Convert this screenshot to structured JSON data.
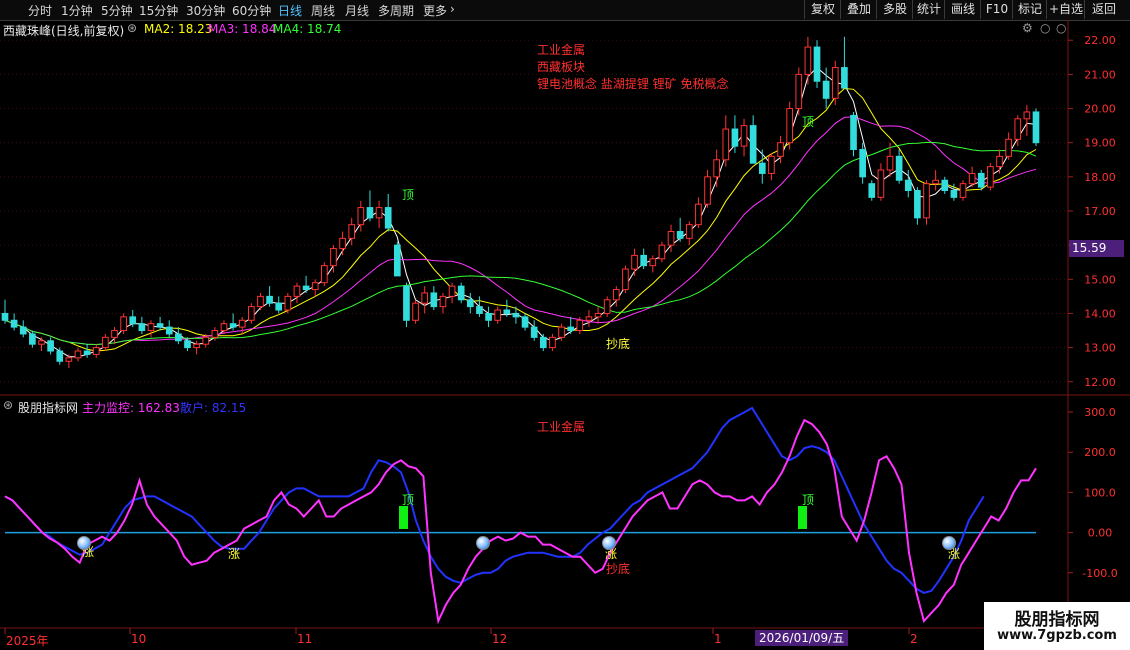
{
  "period_tabs": [
    {
      "label": "分时",
      "active": false
    },
    {
      "label": "1分钟",
      "active": false
    },
    {
      "label": "5分钟",
      "active": false
    },
    {
      "label": "15分钟",
      "active": false
    },
    {
      "label": "30分钟",
      "active": false
    },
    {
      "label": "60分钟",
      "active": false
    },
    {
      "label": "日线",
      "active": true
    },
    {
      "label": "周线",
      "active": false
    },
    {
      "label": "月线",
      "active": false
    },
    {
      "label": "多周期",
      "active": false
    },
    {
      "label": "更多",
      "active": false
    }
  ],
  "toolbar": [
    "复权",
    "叠加",
    "多股",
    "统计",
    "画线",
    "F10",
    "标记",
    "+自选",
    "返回"
  ],
  "main_chart": {
    "title": "西藏珠峰(日线,前复权)",
    "ma_legend": [
      {
        "label": "MA2: 18.23",
        "color": "#ffff00"
      },
      {
        "label": "MA3: 18.84",
        "color": "#ff33ff"
      },
      {
        "label": "MA4: 18.74",
        "color": "#33ff33"
      }
    ],
    "info_lines": [
      "工业金属",
      "西藏板块",
      "锂电池概念 盐湖提锂 锂矿 免税概念"
    ],
    "signals": {
      "top": "顶",
      "bottom": "抄底"
    },
    "price_axis": [
      "22.00",
      "21.00",
      "20.00",
      "19.00",
      "18.00",
      "17.00",
      "16.00",
      "15.00",
      "14.00",
      "13.00",
      "12.00"
    ],
    "current_price": "15.59"
  },
  "indicator": {
    "title": "股朋指标网",
    "legend": [
      {
        "label": "主力监控: 162.83",
        "color": "#ff33ff"
      },
      {
        "label": "散户: 82.15",
        "color": "#3333ff"
      }
    ],
    "sector_label": "工业金属",
    "markers": {
      "rise": "涨",
      "top": "顶",
      "bottom": "抄底"
    },
    "axis": [
      "300.0",
      "200.0",
      "100.0",
      "0.00",
      "-100.0"
    ]
  },
  "date_axis": [
    "2025年",
    "10",
    "11",
    "12",
    "1",
    "2"
  ],
  "cursor_date": "2026/01/09/五",
  "watermark": {
    "name": "股朋指标网",
    "url": "www.7gpzb.com"
  },
  "chart_data": [
    {
      "type": "candlestick",
      "title": "西藏珠峰(日线,前复权)",
      "y_unit": "price",
      "ylim": [
        11.7,
        22.3
      ],
      "x_ticks": [
        "2025年",
        "10",
        "11",
        "12",
        "1",
        "2"
      ],
      "ohlc": [
        [
          14.0,
          14.4,
          13.7,
          13.8
        ],
        [
          13.8,
          14.0,
          13.5,
          13.6
        ],
        [
          13.6,
          13.8,
          13.3,
          13.4
        ],
        [
          13.4,
          13.5,
          13.0,
          13.1
        ],
        [
          13.1,
          13.3,
          12.9,
          13.2
        ],
        [
          13.2,
          13.3,
          12.8,
          12.9
        ],
        [
          12.9,
          13.0,
          12.5,
          12.6
        ],
        [
          12.6,
          12.8,
          12.4,
          12.7
        ],
        [
          12.7,
          13.0,
          12.6,
          12.9
        ],
        [
          12.9,
          13.1,
          12.7,
          12.8
        ],
        [
          12.8,
          13.1,
          12.7,
          13.0
        ],
        [
          13.0,
          13.4,
          12.9,
          13.3
        ],
        [
          13.3,
          13.6,
          13.1,
          13.5
        ],
        [
          13.5,
          14.0,
          13.4,
          13.9
        ],
        [
          13.9,
          14.1,
          13.6,
          13.7
        ],
        [
          13.7,
          13.9,
          13.4,
          13.5
        ],
        [
          13.5,
          13.8,
          13.3,
          13.7
        ],
        [
          13.7,
          13.9,
          13.5,
          13.6
        ],
        [
          13.6,
          13.8,
          13.3,
          13.4
        ],
        [
          13.4,
          13.6,
          13.1,
          13.2
        ],
        [
          13.2,
          13.3,
          12.9,
          13.0
        ],
        [
          13.0,
          13.2,
          12.8,
          13.1
        ],
        [
          13.1,
          13.4,
          13.0,
          13.3
        ],
        [
          13.3,
          13.6,
          13.2,
          13.5
        ],
        [
          13.5,
          13.8,
          13.4,
          13.7
        ],
        [
          13.7,
          14.0,
          13.5,
          13.6
        ],
        [
          13.6,
          13.9,
          13.4,
          13.8
        ],
        [
          13.8,
          14.3,
          13.7,
          14.2
        ],
        [
          14.2,
          14.6,
          14.1,
          14.5
        ],
        [
          14.5,
          14.8,
          14.2,
          14.3
        ],
        [
          14.3,
          14.5,
          14.0,
          14.1
        ],
        [
          14.1,
          14.6,
          14.0,
          14.5
        ],
        [
          14.5,
          14.9,
          14.3,
          14.8
        ],
        [
          14.8,
          15.1,
          14.6,
          14.7
        ],
        [
          14.7,
          15.0,
          14.5,
          14.9
        ],
        [
          14.9,
          15.5,
          14.8,
          15.4
        ],
        [
          15.4,
          16.0,
          15.2,
          15.9
        ],
        [
          15.9,
          16.4,
          15.7,
          16.2
        ],
        [
          16.2,
          16.8,
          16.0,
          16.6
        ],
        [
          16.6,
          17.3,
          16.4,
          17.1
        ],
        [
          17.1,
          17.6,
          16.7,
          16.8
        ],
        [
          16.8,
          17.3,
          16.5,
          17.1
        ],
        [
          17.1,
          17.5,
          16.4,
          16.5
        ],
        [
          16.0,
          16.1,
          15.1,
          15.1
        ],
        [
          14.8,
          14.9,
          13.6,
          13.8
        ],
        [
          13.8,
          14.4,
          13.7,
          14.3
        ],
        [
          14.3,
          14.8,
          14.0,
          14.6
        ],
        [
          14.6,
          14.8,
          14.1,
          14.2
        ],
        [
          14.2,
          14.6,
          14.0,
          14.5
        ],
        [
          14.5,
          14.9,
          14.3,
          14.8
        ],
        [
          14.8,
          14.9,
          14.3,
          14.4
        ],
        [
          14.4,
          14.6,
          14.0,
          14.2
        ],
        [
          14.2,
          14.5,
          13.9,
          14.0
        ],
        [
          14.0,
          14.2,
          13.6,
          13.8
        ],
        [
          13.8,
          14.2,
          13.7,
          14.1
        ],
        [
          14.1,
          14.4,
          13.9,
          14.0
        ],
        [
          14.0,
          14.2,
          13.7,
          13.9
        ],
        [
          13.9,
          14.0,
          13.5,
          13.6
        ],
        [
          13.6,
          13.8,
          13.2,
          13.3
        ],
        [
          13.3,
          13.4,
          12.9,
          13.0
        ],
        [
          13.0,
          13.4,
          12.9,
          13.3
        ],
        [
          13.3,
          13.7,
          13.2,
          13.6
        ],
        [
          13.6,
          13.9,
          13.4,
          13.5
        ],
        [
          13.5,
          13.9,
          13.4,
          13.8
        ],
        [
          13.8,
          14.1,
          13.6,
          13.9
        ],
        [
          13.9,
          14.2,
          13.7,
          14.0
        ],
        [
          14.0,
          14.5,
          13.9,
          14.4
        ],
        [
          14.4,
          14.8,
          14.2,
          14.7
        ],
        [
          14.7,
          15.4,
          14.6,
          15.3
        ],
        [
          15.3,
          15.9,
          15.1,
          15.7
        ],
        [
          15.7,
          15.9,
          15.3,
          15.4
        ],
        [
          15.4,
          15.7,
          15.2,
          15.6
        ],
        [
          15.6,
          16.1,
          15.5,
          16.0
        ],
        [
          16.0,
          16.6,
          15.8,
          16.4
        ],
        [
          16.4,
          16.8,
          16.1,
          16.2
        ],
        [
          16.2,
          16.7,
          16.0,
          16.6
        ],
        [
          16.6,
          17.4,
          16.5,
          17.2
        ],
        [
          17.2,
          18.2,
          17.1,
          18.0
        ],
        [
          18.0,
          18.8,
          17.7,
          18.5
        ],
        [
          18.5,
          19.8,
          18.3,
          19.4
        ],
        [
          19.4,
          19.8,
          18.7,
          18.9
        ],
        [
          18.9,
          19.7,
          18.6,
          19.5
        ],
        [
          19.5,
          19.8,
          18.6,
          18.4
        ],
        [
          18.4,
          18.8,
          17.8,
          18.1
        ],
        [
          18.1,
          18.7,
          17.9,
          18.6
        ],
        [
          18.6,
          19.2,
          18.4,
          19.0
        ],
        [
          19.0,
          20.2,
          18.8,
          20.0
        ],
        [
          20.0,
          21.2,
          19.8,
          21.0
        ],
        [
          21.0,
          22.1,
          20.7,
          21.8
        ],
        [
          21.8,
          22.0,
          20.6,
          20.8
        ],
        [
          20.8,
          21.2,
          20.0,
          20.3
        ],
        [
          20.3,
          21.4,
          20.1,
          21.2
        ],
        [
          21.2,
          22.1,
          20.6,
          20.6
        ],
        [
          19.8,
          19.9,
          18.6,
          18.8
        ],
        [
          18.8,
          19.0,
          17.8,
          18.0
        ],
        [
          17.8,
          17.9,
          17.3,
          17.4
        ],
        [
          17.4,
          18.4,
          17.3,
          18.2
        ],
        [
          18.2,
          19.0,
          18.0,
          18.6
        ],
        [
          18.6,
          18.8,
          17.8,
          17.9
        ],
        [
          17.9,
          18.2,
          17.4,
          17.6
        ],
        [
          17.6,
          17.7,
          16.6,
          16.8
        ],
        [
          16.8,
          17.9,
          16.6,
          17.8
        ],
        [
          17.8,
          18.2,
          17.6,
          17.9
        ],
        [
          17.9,
          18.0,
          17.5,
          17.6
        ],
        [
          17.6,
          17.8,
          17.3,
          17.4
        ],
        [
          17.4,
          17.9,
          17.3,
          17.8
        ],
        [
          17.8,
          18.3,
          17.7,
          18.1
        ],
        [
          18.1,
          18.2,
          17.6,
          17.7
        ],
        [
          17.7,
          18.4,
          17.6,
          18.3
        ],
        [
          18.3,
          18.8,
          18.1,
          18.6
        ],
        [
          18.6,
          19.3,
          18.5,
          19.1
        ],
        [
          19.1,
          19.8,
          18.9,
          19.7
        ],
        [
          19.7,
          20.1,
          19.2,
          19.9
        ],
        [
          19.9,
          20.0,
          18.9,
          19.0
        ]
      ]
    },
    {
      "type": "line",
      "title": "股朋指标网",
      "ylim": [
        -230,
        330
      ],
      "series": [
        {
          "name": "主力监控",
          "values": [
            90,
            80,
            60,
            40,
            20,
            0,
            -15,
            -25,
            -40,
            -60,
            -75,
            -30,
            -20,
            -10,
            -20,
            0,
            30,
            70,
            130,
            70,
            40,
            20,
            0,
            -20,
            -60,
            -80,
            -75,
            -70,
            -50,
            -40,
            -30,
            -20,
            10,
            20,
            30,
            40,
            80,
            100,
            70,
            60,
            40,
            60,
            80,
            40,
            40,
            60,
            70,
            80,
            90,
            100,
            120,
            150,
            170,
            180,
            165,
            160,
            140,
            -100,
            -220,
            -180,
            -150,
            -130,
            -90,
            -60,
            -40,
            -20,
            -10,
            -20,
            -15,
            0,
            -10,
            -10,
            -30,
            -30,
            -40,
            -50,
            -60,
            -60,
            -80,
            -100,
            -90,
            -50,
            -20,
            10,
            40,
            60,
            80,
            90,
            100,
            60,
            60,
            90,
            120,
            130,
            120,
            100,
            90,
            90,
            80,
            80,
            90,
            70,
            100,
            120,
            150,
            190,
            240,
            280,
            270,
            250,
            220,
            160,
            40,
            10,
            -20,
            30,
            100,
            180,
            190,
            160,
            120,
            -50,
            -150,
            -220,
            -200,
            -180,
            -150,
            -130,
            -80,
            -50,
            -20,
            10,
            40,
            30,
            60,
            100,
            130,
            130,
            160
          ]
        },
        {
          "name": "散户",
          "values": [
            90,
            80,
            60,
            40,
            20,
            0,
            -10,
            -25,
            -35,
            -45,
            -55,
            -50,
            -40,
            -30,
            0,
            30,
            60,
            80,
            85,
            90,
            90,
            80,
            70,
            60,
            50,
            40,
            20,
            0,
            -20,
            -35,
            -40,
            -40,
            -40,
            -20,
            0,
            30,
            60,
            80,
            100,
            110,
            110,
            100,
            90,
            90,
            90,
            90,
            90,
            100,
            110,
            150,
            180,
            175,
            165,
            150,
            100,
            30,
            -20,
            -60,
            -90,
            -110,
            -120,
            -125,
            -115,
            -105,
            -100,
            -100,
            -90,
            -70,
            -60,
            -55,
            -50,
            -50,
            -50,
            -55,
            -60,
            -60,
            -60,
            -50,
            -30,
            -15,
            0,
            10,
            30,
            50,
            70,
            80,
            100,
            110,
            120,
            130,
            140,
            150,
            160,
            180,
            200,
            230,
            260,
            280,
            290,
            300,
            310,
            280,
            250,
            220,
            190,
            180,
            190,
            210,
            215,
            210,
            200,
            180,
            140,
            100,
            60,
            20,
            -10,
            -40,
            -70,
            -90,
            -100,
            -120,
            -140,
            -150,
            -145,
            -120,
            -90,
            -60,
            -20,
            30,
            60,
            90
          ]
        }
      ]
    }
  ]
}
